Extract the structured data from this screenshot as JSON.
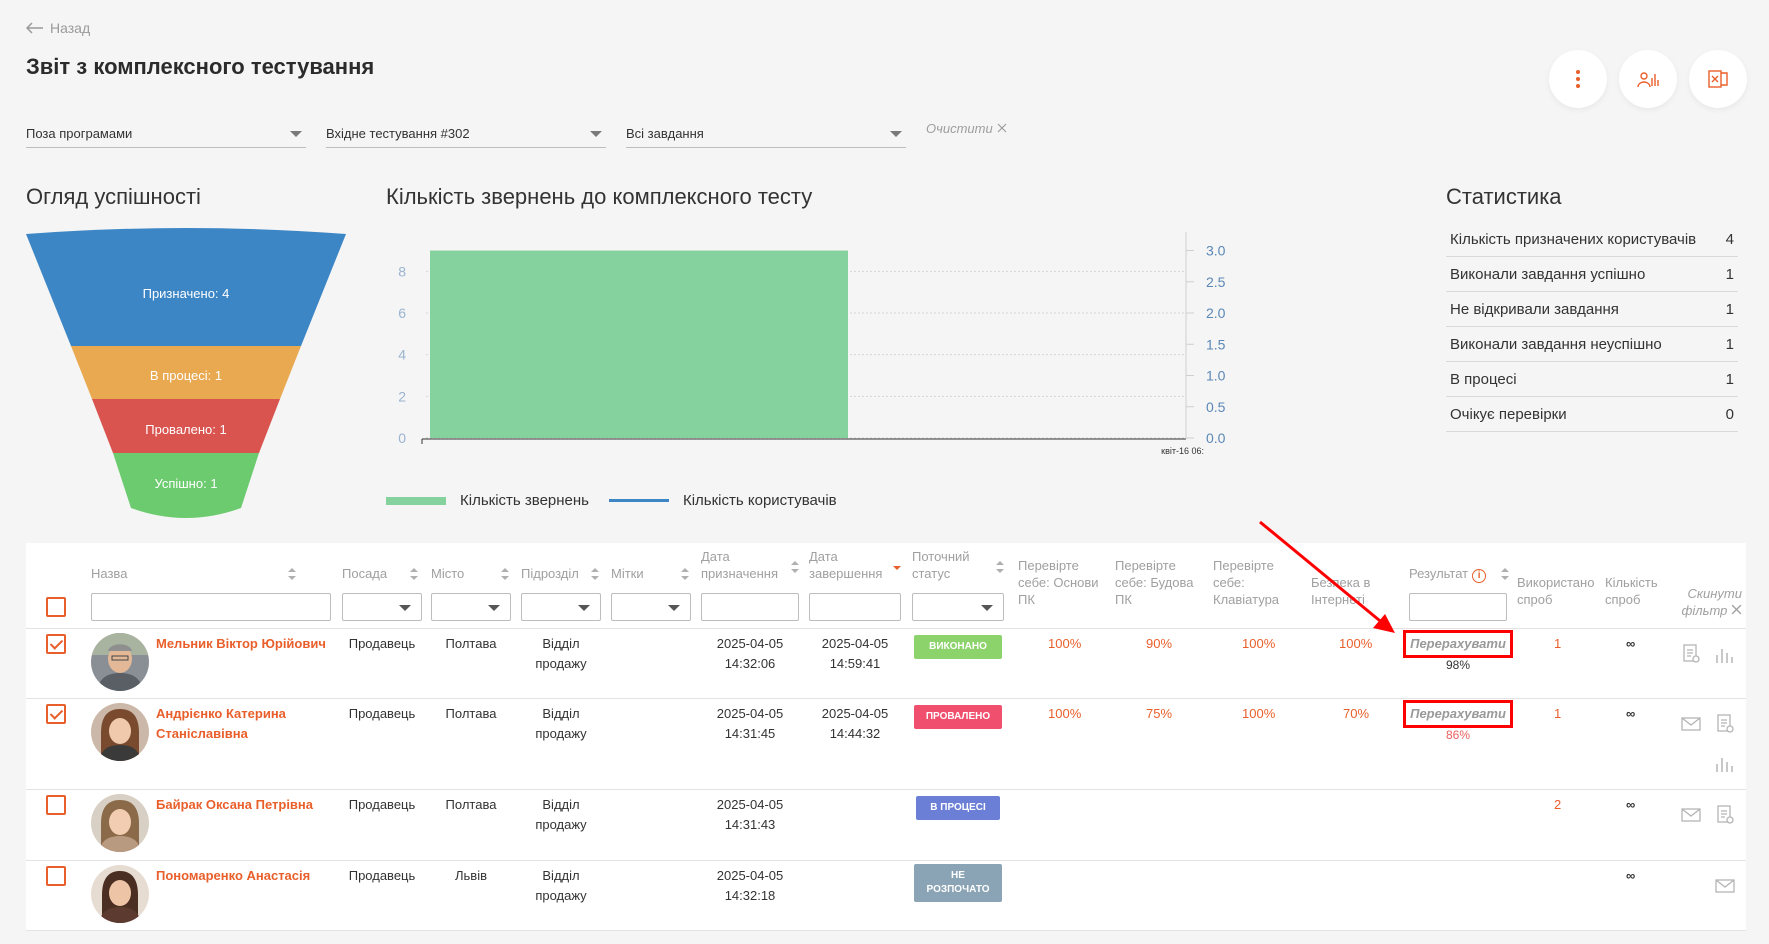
{
  "header": {
    "back_label": "Назад",
    "title": "Звіт з комплексного тестування",
    "actions": [
      "more-vertical-icon",
      "chart-people-icon",
      "excel-icon"
    ]
  },
  "filters": {
    "program": "Поза програмами",
    "test": "Вхідне тестування #302",
    "tasks": "Всі завдання",
    "clear_label": "Очистити"
  },
  "funnel": {
    "title": "Огляд успішності",
    "stages": [
      {
        "label": "Призначено: 4",
        "value": 4,
        "color": "#3d86c6"
      },
      {
        "label": "В процесі: 1",
        "value": 1,
        "color": "#e8a951"
      },
      {
        "label": "Провалено: 1",
        "value": 1,
        "color": "#d9534f"
      },
      {
        "label": "Успішно: 1",
        "value": 1,
        "color": "#6ccb6e"
      }
    ]
  },
  "chart_data": {
    "type": "bar",
    "title": "Кількість звернень до комплексного тесту",
    "categories": [
      "квіт-16 06:"
    ],
    "series": [
      {
        "name": "Кількість звернень",
        "values": [
          9
        ],
        "color": "#86d29e",
        "axis": "left"
      },
      {
        "name": "Кількість користувачів",
        "values": [],
        "color": "#3d86c6",
        "axis": "right"
      }
    ],
    "y_left_ticks": [
      "0",
      "2",
      "4",
      "6",
      "8"
    ],
    "y_left_range": [
      0,
      9.6
    ],
    "y_right_ticks": [
      "0.0",
      "0.5",
      "1.0",
      "1.5",
      "2.0",
      "2.5",
      "3.0"
    ],
    "y_right_range": [
      0,
      3.2
    ],
    "grid": true,
    "legend": "bottom-left"
  },
  "stats": {
    "title": "Статистика",
    "rows": [
      {
        "label": "Кількість призначених користувачів",
        "value": "4"
      },
      {
        "label": "Виконали завдання успішно",
        "value": "1"
      },
      {
        "label": "Не відкривали завдання",
        "value": "1"
      },
      {
        "label": "Виконали завдання неуспішно",
        "value": "1"
      },
      {
        "label": "В процесі",
        "value": "1"
      },
      {
        "label": "Очікує перевірки",
        "value": "0"
      }
    ]
  },
  "table": {
    "headers": {
      "name": "Назва",
      "position": "Посада",
      "city": "Місто",
      "department": "Підрозділ",
      "tags": "Мітки",
      "assigned_1": "Дата",
      "assigned_2": "призначення",
      "finished_1": "Дата",
      "finished_2": "завершення",
      "status_1": "Поточний",
      "status_2": "статус",
      "t1_1": "Перевірте",
      "t1_2": "себе: Основи",
      "t1_3": "ПК",
      "t2_1": "Перевірте",
      "t2_2": "себе: Будова",
      "t2_3": "ПК",
      "t3_1": "Перевірте",
      "t3_2": "себе:",
      "t3_3": "Клавіатура",
      "t4_1": "Безпека в",
      "t4_2": "Інтернеті",
      "result": "Результат",
      "used_1": "Використано",
      "used_2": "спроб",
      "count_1": "Кількість",
      "count_2": "спроб",
      "reset_1": "Скинути",
      "reset_2": "фільтр"
    },
    "recalc_label": "Перерахувати",
    "rows": [
      {
        "checked": true,
        "name_1": "Мельник Віктор Юрійович",
        "name_2": "",
        "position": "Продавець",
        "city": "Полтава",
        "dept_1": "Відділ",
        "dept_2": "продажу",
        "assigned_date": "2025-04-05",
        "assigned_time": "14:32:06",
        "finished_date": "2025-04-05",
        "finished_time": "14:59:41",
        "status_1": "ВИКОНАНО",
        "status_2": "",
        "status_color": "#8dd36c",
        "t1": "100%",
        "t2": "90%",
        "t3": "100%",
        "t4": "100%",
        "result": "98%",
        "result_color": "#333",
        "used": "1",
        "count": "∞",
        "actions": [
          "report-icon",
          "stats-icon"
        ]
      },
      {
        "checked": true,
        "name_1": "Андрієнко Катерина",
        "name_2": "Станіславівна",
        "position": "Продавець",
        "city": "Полтава",
        "dept_1": "Відділ",
        "dept_2": "продажу",
        "assigned_date": "2025-04-05",
        "assigned_time": "14:31:45",
        "finished_date": "2025-04-05",
        "finished_time": "14:44:32",
        "status_1": "ПРОВАЛЕНО",
        "status_2": "",
        "status_color": "#f0506e",
        "t1": "100%",
        "t2": "75%",
        "t3": "100%",
        "t4": "70%",
        "result": "86%",
        "result_color": "#e95f5f",
        "used": "1",
        "count": "∞",
        "actions": [
          "mail-icon",
          "report-icon",
          "stats-icon"
        ]
      },
      {
        "checked": false,
        "name_1": "Байрак Оксана Петрівна",
        "name_2": "",
        "position": "Продавець",
        "city": "Полтава",
        "dept_1": "Відділ",
        "dept_2": "продажу",
        "assigned_date": "2025-04-05",
        "assigned_time": "14:31:43",
        "finished_date": "",
        "finished_time": "",
        "status_1": "В ПРОЦЕСІ",
        "status_2": "",
        "status_color": "#6b7fd7",
        "t1": "",
        "t2": "",
        "t3": "",
        "t4": "",
        "result": "",
        "result_color": "#333",
        "used": "2",
        "count": "∞",
        "actions": [
          "mail-icon",
          "report-icon"
        ]
      },
      {
        "checked": false,
        "name_1": "Пономаренко Анастасія",
        "name_2": "",
        "position": "Продавець",
        "city": "Львів",
        "dept_1": "Відділ",
        "dept_2": "продажу",
        "assigned_date": "2025-04-05",
        "assigned_time": "14:32:18",
        "finished_date": "",
        "finished_time": "",
        "status_1": "НЕ",
        "status_2": "РОЗПОЧАТО",
        "status_color": "#8aa3b5",
        "t1": "",
        "t2": "",
        "t3": "",
        "t4": "",
        "result": "",
        "result_color": "#333",
        "used": "",
        "count": "∞",
        "actions": [
          "mail-icon"
        ]
      }
    ]
  }
}
